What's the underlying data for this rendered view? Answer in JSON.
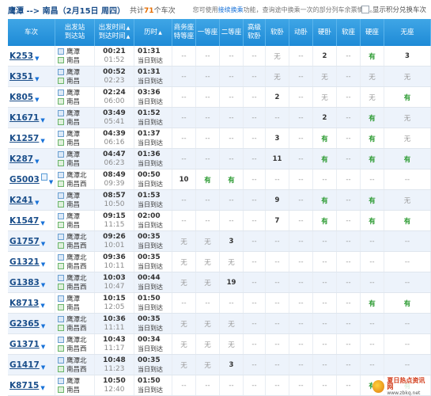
{
  "top": {
    "route": "鹰潭 --> 南昌",
    "date": "（2月15日 周四）",
    "total_prefix": "共计",
    "total_count": "71",
    "total_suffix": "个车次",
    "tip_prefix": "您可使用",
    "tip_link": "接续换乘",
    "tip_suffix": "功能，查询途中换乘一次的部分列车余票情况。",
    "points_label": "显示积分兑换车次"
  },
  "headers": {
    "train": "车次",
    "station_top": "出发站",
    "station_bottom": "到达站",
    "time_top": "出发时间",
    "time_bottom": "到达时间",
    "duration": "历时",
    "biz_top": "商务座",
    "biz_bottom": "特等座",
    "first": "一等座",
    "second": "二等座",
    "adv_top": "高级",
    "adv_bottom": "软卧",
    "soft_sleeper": "软卧",
    "bullet_sleeper": "动卧",
    "hard_sleeper": "硬卧",
    "soft_seat": "软座",
    "hard_seat": "硬座",
    "no_seat": "无座"
  },
  "rows": [
    {
      "train": "K253",
      "badge": false,
      "from": "鹰潭",
      "to": "南昌",
      "dep": "00:21",
      "arr": "01:52",
      "dur": "01:31",
      "note": "当日到达",
      "seats": [
        "--",
        "--",
        "--",
        "--",
        "无",
        "--",
        "2",
        "--",
        "有",
        "3"
      ]
    },
    {
      "train": "K351",
      "badge": false,
      "from": "鹰潭",
      "to": "南昌",
      "dep": "00:52",
      "arr": "02:23",
      "dur": "01:31",
      "note": "当日到达",
      "seats": [
        "--",
        "--",
        "--",
        "--",
        "无",
        "--",
        "无",
        "--",
        "无",
        "无"
      ]
    },
    {
      "train": "K805",
      "badge": false,
      "from": "鹰潭",
      "to": "南昌",
      "dep": "02:24",
      "arr": "06:00",
      "dur": "03:36",
      "note": "当日到达",
      "seats": [
        "--",
        "--",
        "--",
        "--",
        "2",
        "--",
        "无",
        "--",
        "无",
        "有"
      ]
    },
    {
      "train": "K1671",
      "badge": false,
      "from": "鹰潭",
      "to": "南昌",
      "dep": "03:49",
      "arr": "05:41",
      "dur": "01:52",
      "note": "当日到达",
      "seats": [
        "--",
        "--",
        "--",
        "--",
        "--",
        "--",
        "2",
        "--",
        "有",
        "无"
      ]
    },
    {
      "train": "K1257",
      "badge": false,
      "from": "鹰潭",
      "to": "南昌",
      "dep": "04:39",
      "arr": "06:16",
      "dur": "01:37",
      "note": "当日到达",
      "seats": [
        "--",
        "--",
        "--",
        "--",
        "3",
        "--",
        "有",
        "--",
        "有",
        "无"
      ]
    },
    {
      "train": "K287",
      "badge": false,
      "from": "鹰潭",
      "to": "南昌",
      "dep": "04:47",
      "arr": "06:23",
      "dur": "01:36",
      "note": "当日到达",
      "seats": [
        "--",
        "--",
        "--",
        "--",
        "11",
        "--",
        "有",
        "--",
        "有",
        "有"
      ]
    },
    {
      "train": "G5003",
      "badge": true,
      "from": "鹰潭北",
      "to": "南昌西",
      "dep": "08:49",
      "arr": "09:39",
      "dur": "00:50",
      "note": "当日到达",
      "seats": [
        "10",
        "有",
        "有",
        "--",
        "--",
        "--",
        "--",
        "--",
        "--",
        "--"
      ]
    },
    {
      "train": "K241",
      "badge": false,
      "from": "鹰潭",
      "to": "南昌",
      "dep": "08:57",
      "arr": "10:50",
      "dur": "01:53",
      "note": "当日到达",
      "seats": [
        "--",
        "--",
        "--",
        "--",
        "9",
        "--",
        "有",
        "--",
        "有",
        "无"
      ]
    },
    {
      "train": "K1547",
      "badge": false,
      "from": "鹰潭",
      "to": "南昌",
      "dep": "09:15",
      "arr": "11:15",
      "dur": "02:00",
      "note": "当日到达",
      "seats": [
        "--",
        "--",
        "--",
        "--",
        "7",
        "--",
        "有",
        "--",
        "有",
        "有"
      ]
    },
    {
      "train": "G1757",
      "badge": false,
      "from": "鹰潭北",
      "to": "南昌西",
      "dep": "09:26",
      "arr": "10:01",
      "dur": "00:35",
      "note": "当日到达",
      "seats": [
        "无",
        "无",
        "3",
        "--",
        "--",
        "--",
        "--",
        "--",
        "--",
        "--"
      ]
    },
    {
      "train": "G1321",
      "badge": false,
      "from": "鹰潭北",
      "to": "南昌西",
      "dep": "09:36",
      "arr": "10:11",
      "dur": "00:35",
      "note": "当日到达",
      "seats": [
        "无",
        "无",
        "无",
        "--",
        "--",
        "--",
        "--",
        "--",
        "--",
        "--"
      ]
    },
    {
      "train": "G1383",
      "badge": false,
      "from": "鹰潭北",
      "to": "南昌西",
      "dep": "10:03",
      "arr": "10:47",
      "dur": "00:44",
      "note": "当日到达",
      "seats": [
        "无",
        "无",
        "19",
        "--",
        "--",
        "--",
        "--",
        "--",
        "--",
        "--"
      ]
    },
    {
      "train": "K8713",
      "badge": false,
      "from": "鹰潭",
      "to": "南昌",
      "dep": "10:15",
      "arr": "12:05",
      "dur": "01:50",
      "note": "当日到达",
      "seats": [
        "--",
        "--",
        "--",
        "--",
        "--",
        "--",
        "--",
        "--",
        "有",
        "有"
      ]
    },
    {
      "train": "G2365",
      "badge": false,
      "from": "鹰潭北",
      "to": "南昌西",
      "dep": "10:36",
      "arr": "11:11",
      "dur": "00:35",
      "note": "当日到达",
      "seats": [
        "无",
        "无",
        "无",
        "--",
        "--",
        "--",
        "--",
        "--",
        "--",
        "--"
      ]
    },
    {
      "train": "G1371",
      "badge": false,
      "from": "鹰潭北",
      "to": "南昌西",
      "dep": "10:43",
      "arr": "11:17",
      "dur": "00:34",
      "note": "当日到达",
      "seats": [
        "无",
        "无",
        "无",
        "--",
        "--",
        "--",
        "--",
        "--",
        "--",
        "--"
      ]
    },
    {
      "train": "G1417",
      "badge": false,
      "from": "鹰潭北",
      "to": "南昌西",
      "dep": "10:48",
      "arr": "11:23",
      "dur": "00:35",
      "note": "当日到达",
      "seats": [
        "无",
        "无",
        "3",
        "--",
        "--",
        "--",
        "--",
        "--",
        "--",
        "--"
      ]
    },
    {
      "train": "K8715",
      "badge": false,
      "from": "鹰潭",
      "to": "南昌",
      "dep": "10:50",
      "arr": "12:40",
      "dur": "01:50",
      "note": "当日到达",
      "seats": [
        "--",
        "--",
        "--",
        "--",
        "--",
        "--",
        "--",
        "--",
        "有",
        "有"
      ]
    }
  ],
  "watermark": {
    "title": "夏日热点资讯网",
    "url": "www.zbkq.net"
  },
  "colors": {
    "header_blue": "#1e8ad6",
    "link_blue": "#1a4e8a",
    "available_green": "#2a9a30",
    "row_alt": "#edf3fb"
  }
}
